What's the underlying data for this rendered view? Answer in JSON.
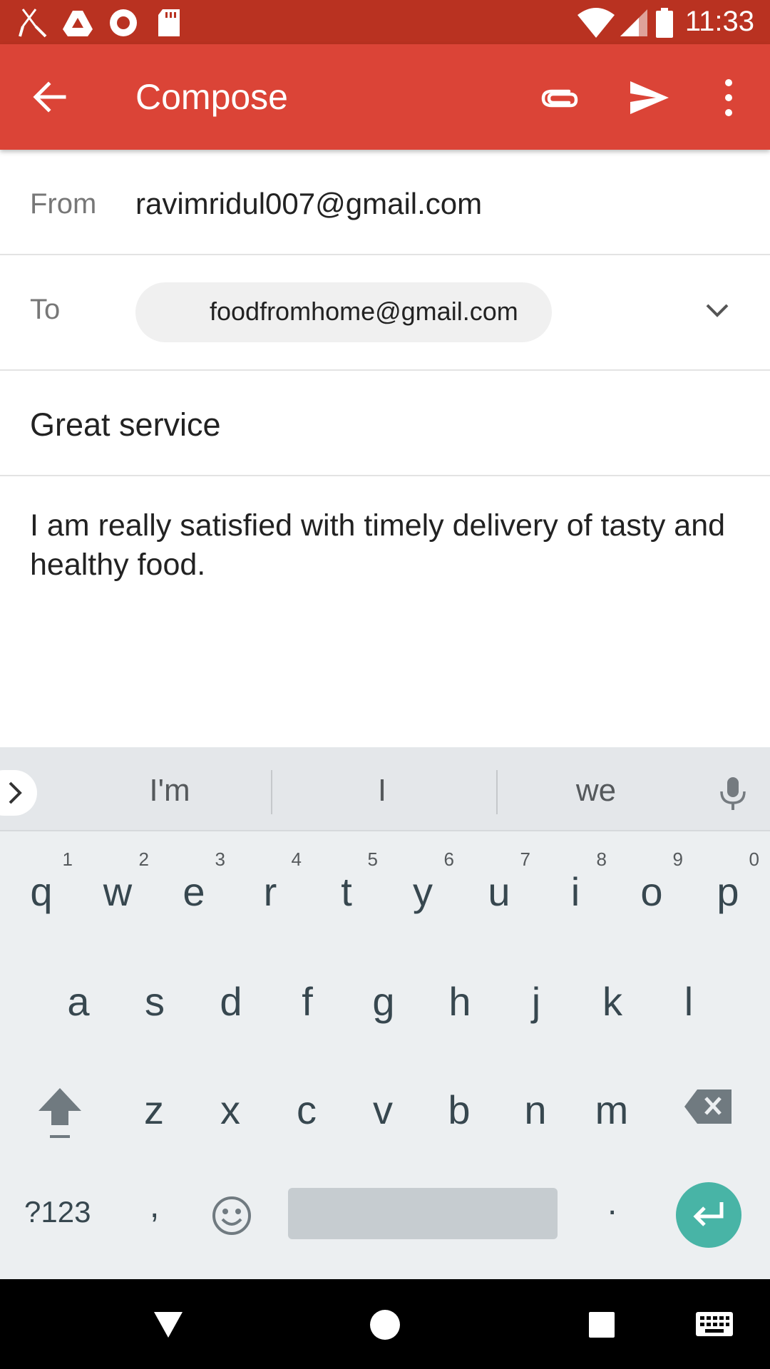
{
  "status_bar": {
    "time": "11:33",
    "left_icons": [
      "utensils-icon",
      "drive-icon",
      "record-icon",
      "sd-card-icon"
    ],
    "right_icons": [
      "wifi-icon",
      "signal-icon",
      "battery-icon"
    ]
  },
  "app_bar": {
    "title": "Compose",
    "actions": [
      "back-arrow-icon",
      "attach-icon",
      "send-icon",
      "more-vert-icon"
    ]
  },
  "compose": {
    "from_label": "From",
    "from_value": "ravimridul007@gmail.com",
    "to_label": "To",
    "to_chip": "foodfromhome@gmail.com",
    "subject": "Great service",
    "body": "I am really satisfied with timely delivery of tasty and healthy food."
  },
  "keyboard": {
    "suggestions": [
      "I'm",
      "I",
      "we"
    ],
    "row1": [
      {
        "ch": "q",
        "hint": "1"
      },
      {
        "ch": "w",
        "hint": "2"
      },
      {
        "ch": "e",
        "hint": "3"
      },
      {
        "ch": "r",
        "hint": "4"
      },
      {
        "ch": "t",
        "hint": "5"
      },
      {
        "ch": "y",
        "hint": "6"
      },
      {
        "ch": "u",
        "hint": "7"
      },
      {
        "ch": "i",
        "hint": "8"
      },
      {
        "ch": "o",
        "hint": "9"
      },
      {
        "ch": "p",
        "hint": "0"
      }
    ],
    "row2": [
      "a",
      "s",
      "d",
      "f",
      "g",
      "h",
      "j",
      "k",
      "l"
    ],
    "row3": [
      "z",
      "x",
      "c",
      "v",
      "b",
      "n",
      "m"
    ],
    "symbols_label": "?123",
    "comma": ",",
    "period": ".",
    "accent_color": "#48b4a6"
  },
  "colors": {
    "status_bar": "#b93221",
    "app_bar": "#db4437"
  }
}
